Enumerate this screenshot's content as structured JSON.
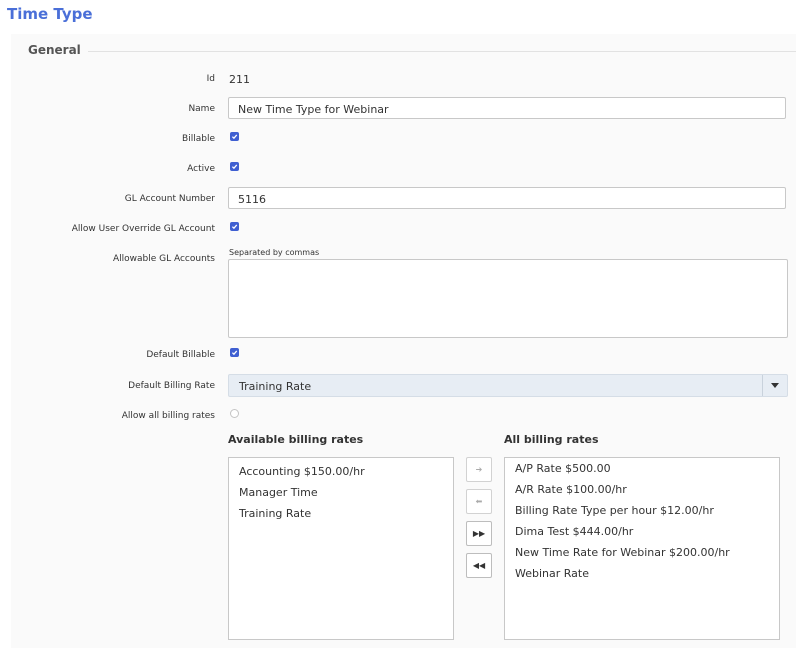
{
  "page_title": "Time Type",
  "section": {
    "legend": "General"
  },
  "form": {
    "id_label": "Id",
    "id_value": "211",
    "name_label": "Name",
    "name_value": "New Time Type for Webinar",
    "billable_label": "Billable",
    "billable_checked": true,
    "active_label": "Active",
    "active_checked": true,
    "gl_label": "GL Account Number",
    "gl_value": "5116",
    "override_label": "Allow User Override GL Account",
    "override_checked": true,
    "allowable_label": "Allowable GL Accounts",
    "allowable_hint": "Separated by commas",
    "allowable_value": "",
    "default_billable_label": "Default Billable",
    "default_billable_checked": true,
    "default_rate_label": "Default Billing Rate",
    "default_rate_value": "Training Rate",
    "allow_all_label": "Allow all billing rates",
    "allow_all_checked": false
  },
  "lists": {
    "available_title": "Available billing rates",
    "available": [
      "Accounting $150.00/hr",
      "Manager Time",
      "Training Rate"
    ],
    "all_title": "All billing rates",
    "all": [
      "A/P Rate $500.00",
      "A/R Rate $100.00/hr",
      "Billing Rate Type per hour $12.00/hr",
      "Dima Test $444.00/hr",
      "New Time Rate for Webinar $200.00/hr",
      "Webinar Rate"
    ]
  },
  "buttons": {
    "move_right": "➔",
    "move_left": "⬅",
    "move_all_right": "▶▶",
    "move_all_left": "◀◀"
  },
  "icons": {
    "checkbox": "check-icon",
    "select": "caret-down-icon"
  },
  "colors": {
    "accent": "#3f5fd1",
    "title": "#4a6fd8",
    "select_bg": "#e7edf4"
  }
}
